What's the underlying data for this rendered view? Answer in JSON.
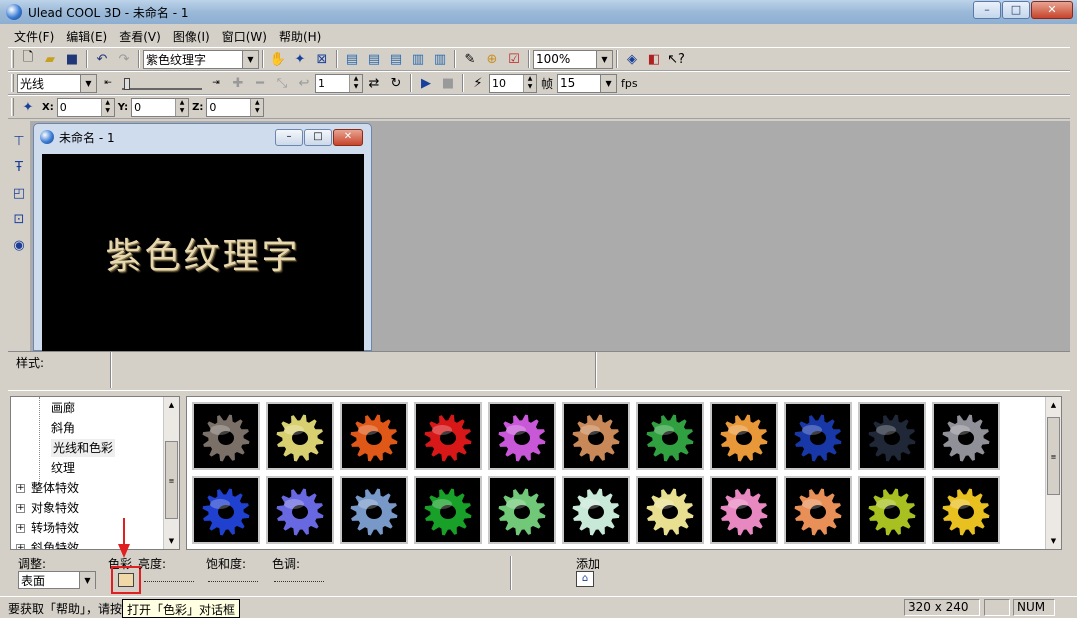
{
  "app": {
    "title": "Ulead COOL 3D - 未命名 - 1",
    "window_buttons": [
      "–",
      "□",
      "✕"
    ]
  },
  "menu": [
    "文件(F)",
    "编辑(E)",
    "查看(V)",
    "图像(I)",
    "窗口(W)",
    "帮助(H)"
  ],
  "toolbar1": {
    "text_combo": "紫色纹理字",
    "zoom_combo": "100%"
  },
  "toolbar2": {
    "mode_combo": "光线",
    "frame_value": "1",
    "frames_value": "10",
    "frame_label": "帧",
    "fps_value": "15",
    "fps_label": "fps"
  },
  "toolbar3": {
    "x_label": "X:",
    "x_value": "0",
    "y_label": "Y:",
    "y_value": "0",
    "z_label": "Z:",
    "z_value": "0"
  },
  "document": {
    "title": "未命名 - 1",
    "canvas_text": "紫色纹理字"
  },
  "style_panel": {
    "label": "样式:"
  },
  "tree": {
    "children": [
      "画廊",
      "斜角",
      "光线和色彩",
      "纹理"
    ],
    "selected": "光线和色彩",
    "groups": [
      "整体特效",
      "对象特效",
      "转场特效",
      "斜角特效"
    ]
  },
  "thumbnails": {
    "row1": [
      "#7a7068",
      "#d8d070",
      "#e05818",
      "#d81818",
      "#c858d8",
      "#c88858",
      "#30a040",
      "#e89838",
      "#1838a8",
      "#202838",
      "#909098"
    ],
    "row2": [
      "#2040d0",
      "#6868e0",
      "#7898c8",
      "#18a028",
      "#70c878",
      "#c8e8d8",
      "#e8e090",
      "#e888c0",
      "#e89058",
      "#a8c020",
      "#e8c020"
    ]
  },
  "adjust": {
    "label": "调整:",
    "surface_combo": "表面",
    "color_label": "色彩",
    "brightness_label": "亮度:",
    "saturation_label": "饱和度:",
    "hue_label": "色调:",
    "add_label": "添加"
  },
  "status": {
    "text": "要获取「帮助」，请按",
    "tooltip": "打开「色彩」对话框",
    "size": "320 x 240",
    "num": "NUM"
  }
}
